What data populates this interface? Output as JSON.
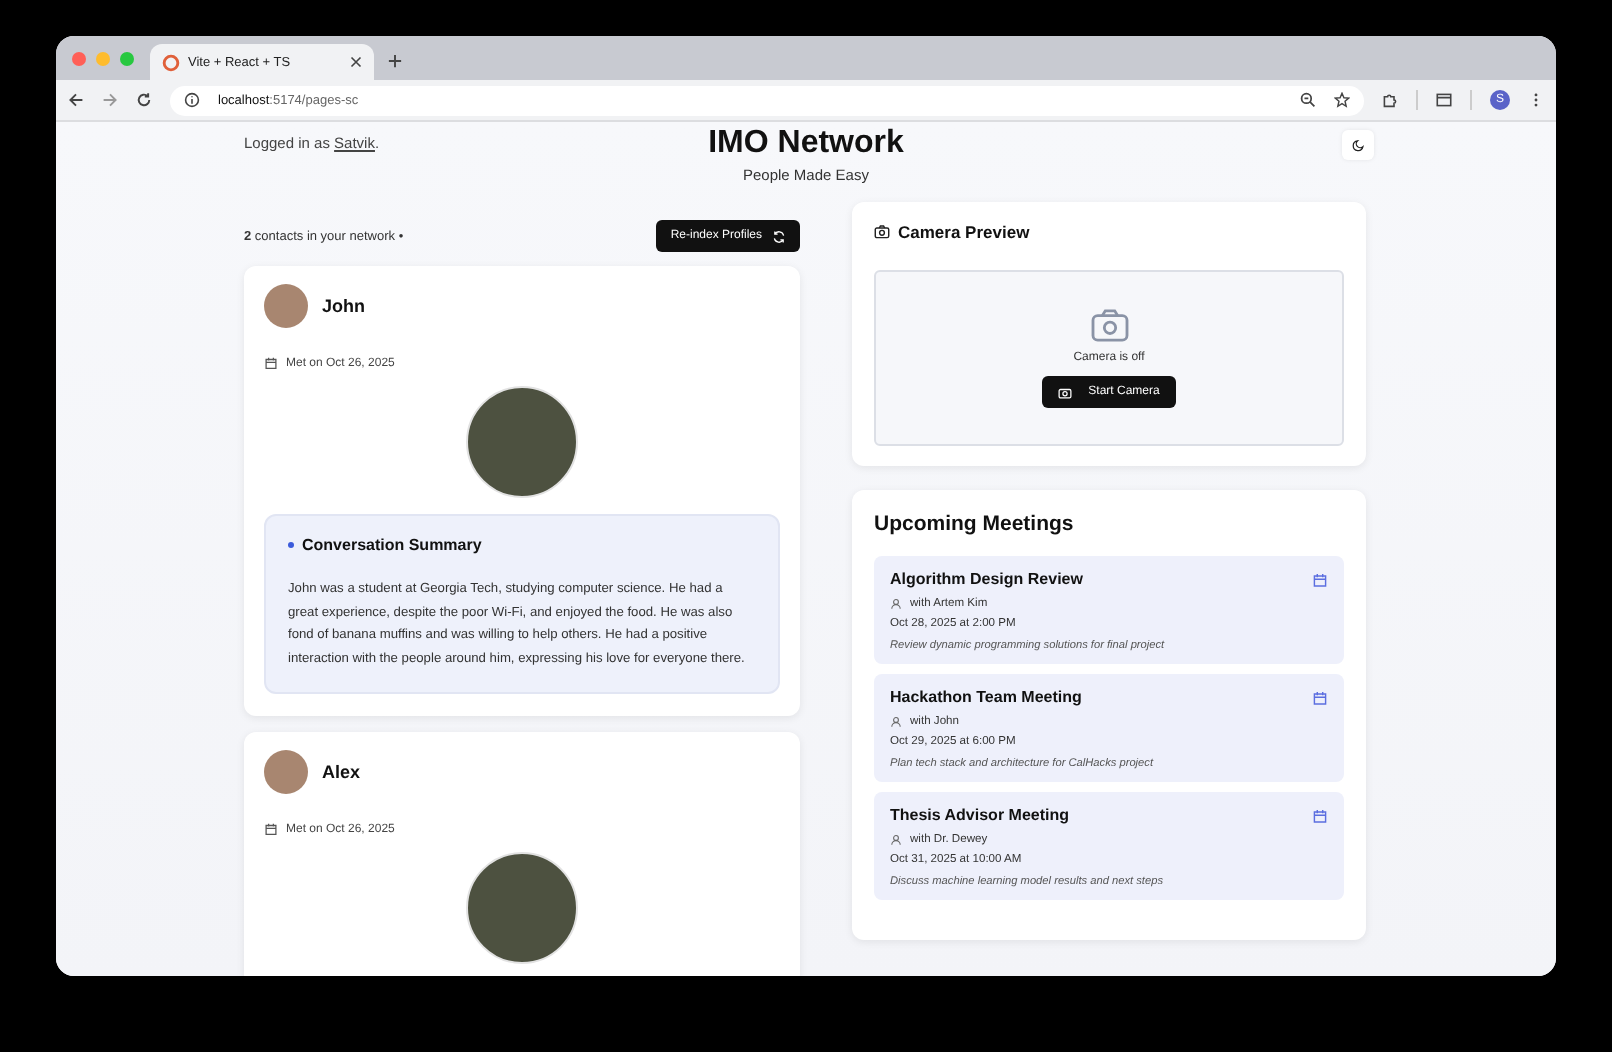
{
  "browser": {
    "tab_title": "Vite + React + TS",
    "url_host": "localhost",
    "url_rest": ":5174/pages-sc",
    "profile_initial": "S"
  },
  "header": {
    "logged_in_prefix": "Logged in as",
    "user": "Satvik",
    "logged_in_suffix": ".",
    "title": "IMO Network",
    "subtitle": "People Made Easy"
  },
  "contacts_bar": {
    "count": "2",
    "count_label": "contacts in your network •",
    "reindex_button": "Re-index Profiles"
  },
  "contacts": [
    {
      "name": "John",
      "met": "Met on Oct 26, 2025",
      "summary_title": "Conversation Summary",
      "summary": "John was a student at Georgia Tech, studying computer science. He had a great experience, despite the poor Wi-Fi, and enjoyed the food. He was also fond of banana muffins and was willing to help others. He had a positive interaction with the people around him, expressing his love for everyone there."
    },
    {
      "name": "Alex",
      "met": "Met on Oct 26, 2025"
    }
  ],
  "camera": {
    "title": "Camera Preview",
    "status": "Camera is off",
    "button": "Start Camera"
  },
  "meetings": {
    "title": "Upcoming Meetings",
    "items": [
      {
        "title": "Algorithm Design Review",
        "with": "with Artem Kim",
        "when": "Oct 28, 2025 at 2:00 PM",
        "note": "Review dynamic programming solutions for final project"
      },
      {
        "title": "Hackathon Team Meeting",
        "with": "with John",
        "when": "Oct 29, 2025 at 6:00 PM",
        "note": "Plan tech stack and architecture for CalHacks project"
      },
      {
        "title": "Thesis Advisor Meeting",
        "with": "with Dr. Dewey",
        "when": "Oct 31, 2025 at 10:00 AM",
        "note": "Discuss machine learning model results and next steps"
      }
    ]
  }
}
